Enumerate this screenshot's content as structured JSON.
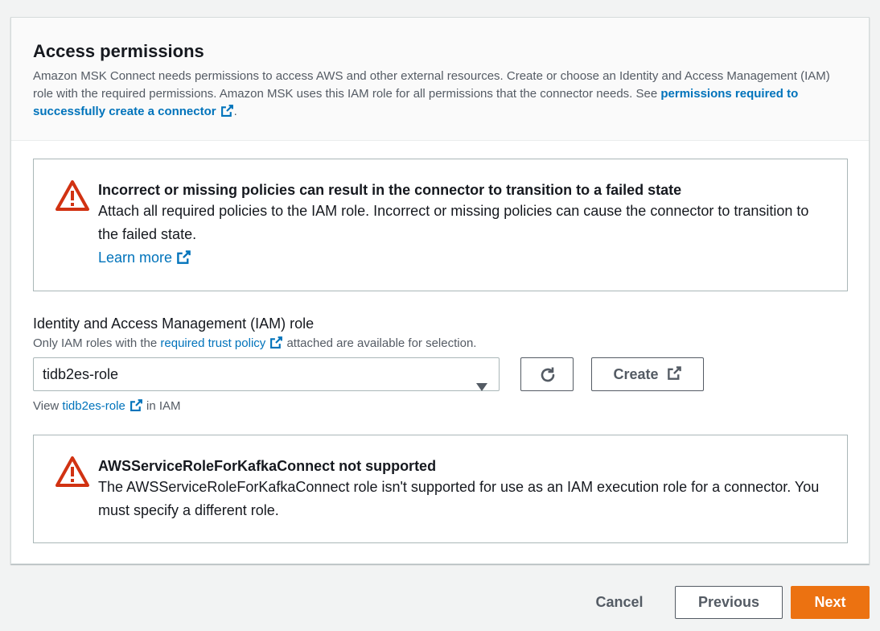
{
  "section": {
    "title": "Access permissions",
    "desc_prefix": "Amazon MSK Connect needs permissions to access AWS and other external resources. Create or choose an Identity and Access Management (IAM) role with the required permissions. Amazon MSK uses this IAM role for all permissions that the connector needs. See ",
    "desc_link": "permissions required to successfully create a connector",
    "desc_suffix": "."
  },
  "alert_policies": {
    "icon": "warning-icon",
    "title": "Incorrect or missing policies can result in the connector to transition to a failed state",
    "text": "Attach all required policies to the IAM role. Incorrect or missing policies can cause the connector to transition to the failed state.",
    "link": "Learn more"
  },
  "iam_role": {
    "label": "Identity and Access Management (IAM) role",
    "desc_prefix": "Only IAM roles with the ",
    "desc_link": "required trust policy",
    "desc_suffix": "attached are available for selection.",
    "selected": "tidb2es-role",
    "refresh_icon": "refresh-icon",
    "create_label": "Create",
    "view_prefix": "View ",
    "view_link": "tidb2es-role",
    "view_suffix": "in IAM"
  },
  "alert_service_role": {
    "icon": "warning-icon",
    "title": "AWSServiceRoleForKafkaConnect not supported",
    "text": "The AWSServiceRoleForKafkaConnect role isn't supported for use as an IAM execution role for a connector. You must specify a different role."
  },
  "footer": {
    "cancel": "Cancel",
    "previous": "Previous",
    "next": "Next"
  },
  "colors": {
    "link": "#0073bb",
    "warning": "#d13212",
    "primary": "#ec7211"
  }
}
